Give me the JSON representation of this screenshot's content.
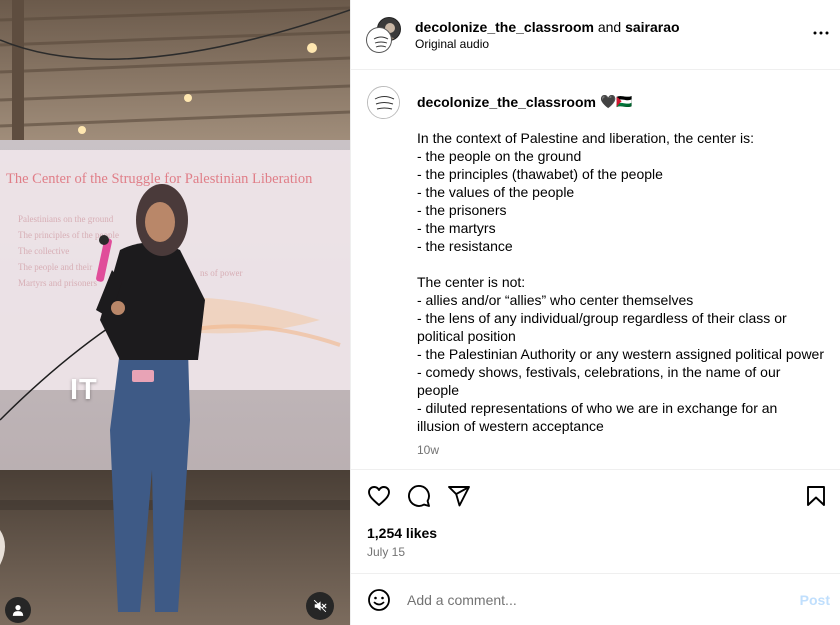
{
  "media": {
    "overlay_caption": "IT",
    "slide_title": "The Center of the Struggle for Palestinian Liberation",
    "slide_lines": [
      "Palestinians on the ground",
      "The principles of the people",
      "The collective",
      "The people and their",
      "Martyrs and prisoners"
    ],
    "slide_fragment": "ns of power"
  },
  "header": {
    "username": "decolonize_the_classroom",
    "joiner": "and",
    "collaborator": "sairarao",
    "audio": "Original audio"
  },
  "caption": {
    "username": "decolonize_the_classroom",
    "emoji": "🖤🇵🇸",
    "text": "In the context of Palestine and liberation, the center is:\n- the people on the ground\n- the principles (thawabet) of the people\n- the values of the people\n- the prisoners\n- the martyrs\n- the resistance\n\nThe center is not:\n- allies and/or “allies” who center themselves\n- the lens of any individual/group regardless of their class or political position\n- the Palestinian Authority or any western assigned political power\n- comedy shows, festivals, celebrations, in the name of our people\n- diluted representations of who we are in exchange for an illusion of western acceptance",
    "time": "10w"
  },
  "engagement": {
    "likes": "1,254 likes",
    "date": "July 15"
  },
  "comment": {
    "placeholder": "Add a comment...",
    "post_label": "Post"
  },
  "icons": {
    "like": "heart-icon",
    "comment": "comment-bubble-icon",
    "share": "paper-plane-icon",
    "save": "bookmark-icon",
    "emoji": "smiley-icon",
    "more": "more-horizontal-icon",
    "mute": "speaker-muted-icon",
    "user_tag": "user-icon"
  },
  "colors": {
    "post_disabled": "#c0dffd",
    "secondary_text": "#737373",
    "divider": "#efefef"
  }
}
